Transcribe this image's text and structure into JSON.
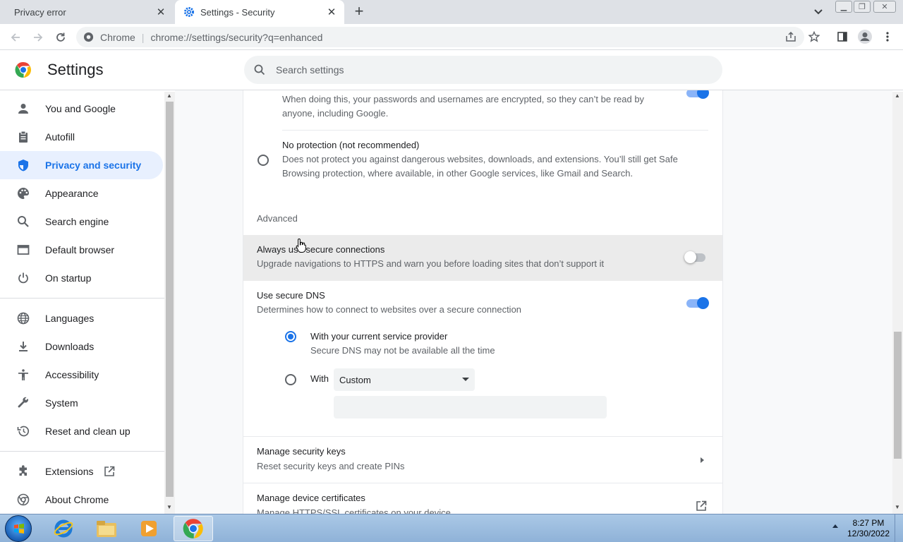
{
  "browser": {
    "tabs": [
      {
        "title": "Privacy error",
        "active": false
      },
      {
        "title": "Settings - Security",
        "active": true
      }
    ],
    "omnibox": {
      "site_label": "Chrome",
      "url": "chrome://settings/security?q=enhanced"
    }
  },
  "settings": {
    "title": "Settings",
    "search_placeholder": "Search settings"
  },
  "sidebar": {
    "items": [
      {
        "label": "You and Google",
        "icon": "person-icon"
      },
      {
        "label": "Autofill",
        "icon": "clipboard-icon"
      },
      {
        "label": "Privacy and security",
        "icon": "shield-icon",
        "active": true
      },
      {
        "label": "Appearance",
        "icon": "palette-icon"
      },
      {
        "label": "Search engine",
        "icon": "search-icon"
      },
      {
        "label": "Default browser",
        "icon": "browser-icon"
      },
      {
        "label": "On startup",
        "icon": "power-icon"
      },
      {
        "label": "Languages",
        "icon": "globe-icon"
      },
      {
        "label": "Downloads",
        "icon": "download-icon"
      },
      {
        "label": "Accessibility",
        "icon": "accessibility-icon"
      },
      {
        "label": "System",
        "icon": "wrench-icon"
      },
      {
        "label": "Reset and clean up",
        "icon": "history-icon"
      },
      {
        "label": "Extensions",
        "icon": "puzzle-icon"
      },
      {
        "label": "About Chrome",
        "icon": "chrome-icon"
      }
    ]
  },
  "security": {
    "sync_desc_line1": "When doing this, your passwords and usernames are encrypted, so they can’t be read by",
    "sync_desc_line2": "anyone, including Google.",
    "no_protection": {
      "title": "No protection (not recommended)",
      "desc_line1": "Does not protect you against dangerous websites, downloads, and extensions. You’ll still get Safe",
      "desc_line2": "Browsing protection, where available, in other Google services, like Gmail and Search."
    },
    "advanced_heading": "Advanced",
    "https_only": {
      "title": "Always use secure connections",
      "desc": "Upgrade navigations to HTTPS and warn you before loading sites that don’t support it",
      "enabled": false
    },
    "secure_dns": {
      "title": "Use secure DNS",
      "desc": "Determines how to connect to websites over a secure connection",
      "enabled": true,
      "current_provider": {
        "title": "With your current service provider",
        "desc": "Secure DNS may not be available all the time",
        "selected": true
      },
      "custom": {
        "label": "With",
        "selected_option": "Custom"
      }
    },
    "security_keys": {
      "title": "Manage security keys",
      "desc": "Reset security keys and create PINs"
    },
    "certificates": {
      "title": "Manage device certificates",
      "desc": "Manage HTTPS/SSL certificates on your device"
    }
  },
  "taskbar": {
    "time": "8:27 PM",
    "date": "12/30/2022"
  },
  "colors": {
    "accent": "#1a73e8",
    "active_nav_bg": "#e8f0fe"
  }
}
